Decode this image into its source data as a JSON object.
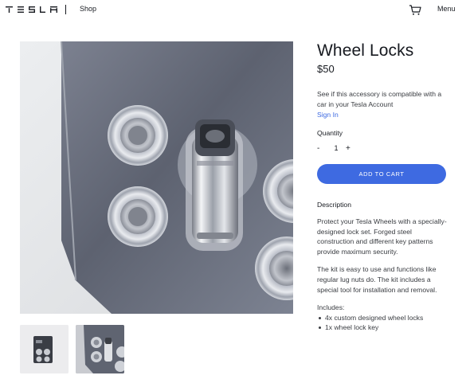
{
  "header": {
    "logo_text": "TESLA",
    "shop_label": "Shop",
    "cart_icon": "cart-icon",
    "menu_label": "Menu"
  },
  "product": {
    "title": "Wheel Locks",
    "price": "$50",
    "compat_text": "See if this accessory is compatible with a car in your Tesla Account",
    "signin_label": "Sign In",
    "quantity_label": "Quantity",
    "qty_minus": "-",
    "qty_value": "1",
    "qty_plus": "+",
    "add_to_cart_label": "ADD TO CART",
    "description_heading": "Description",
    "description_p1": "Protect your Tesla Wheels with a specially-designed lock set. Forged steel construction and different key patterns provide maximum security.",
    "description_p2": "The kit is easy to use and functions like regular lug nuts do. The kit includes a special tool for installation and removal.",
    "includes_label": "Includes:",
    "includes_items": [
      "4x custom designed wheel locks",
      "1x wheel lock key"
    ]
  },
  "gallery": {
    "thumbnail_count": 2,
    "selected_thumbnail": 2
  },
  "colors": {
    "accent": "#3e6ae1",
    "text": "#171a20",
    "muted_text": "#393c41"
  }
}
